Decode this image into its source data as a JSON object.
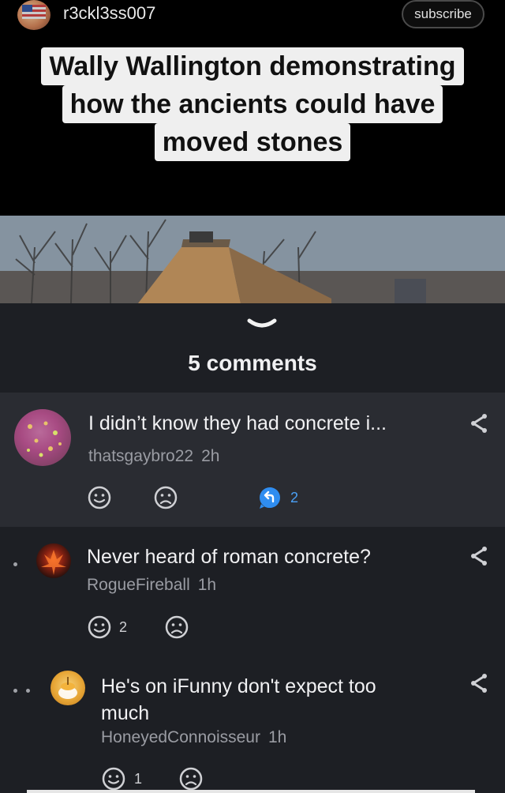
{
  "header": {
    "username": "r3ckl3ss007",
    "subscribe_label": "subscribe",
    "avatar_icon": "flag-avatar-icon"
  },
  "caption": {
    "lines": [
      "Wally Wallington demonstrating",
      "how the ancients could have",
      "moved stones"
    ]
  },
  "comments_panel": {
    "count_label": "5 comments",
    "comments": [
      {
        "text": "I didn’t know they had concrete i...",
        "user": "thatsgaybro22",
        "time": "2h",
        "smile_count": "",
        "reply_count": "2"
      },
      {
        "text": "Never heard of roman concrete?",
        "user": "RogueFireball",
        "time": "1h",
        "smile_count": "2",
        "reply_count": ""
      },
      {
        "text_line1": "He's on iFunny don't expect too",
        "text_line2": "much",
        "user": "HoneyedConnoisseur",
        "time": "1h",
        "smile_count": "1",
        "reply_count": ""
      }
    ]
  },
  "colors": {
    "accent_blue": "#4aa0f5",
    "panel_bg": "#1d1f24",
    "highlight_bg": "#2a2c32"
  }
}
